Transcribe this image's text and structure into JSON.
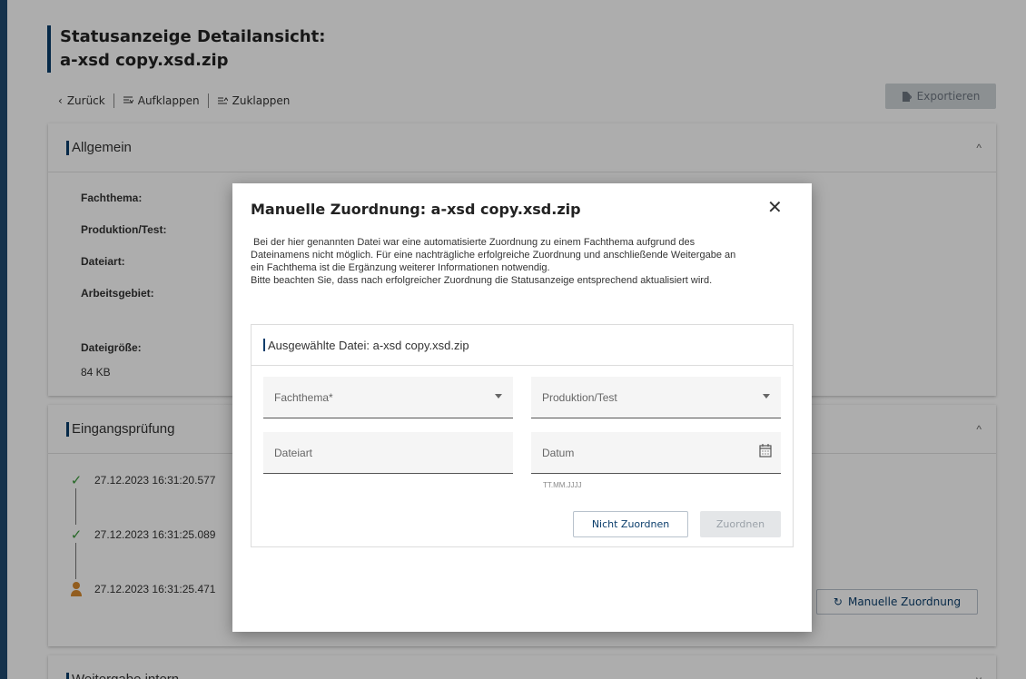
{
  "page": {
    "title_line1": "Statusanzeige Detailansicht:",
    "title_line2": "a-xsd copy.xsd.zip"
  },
  "toolbar": {
    "back_label": "Zurück",
    "expand_label": "Aufklappen",
    "collapse_label": "Zuklappen",
    "export_label": "Exportieren"
  },
  "sections": {
    "general": {
      "title": "Allgemein",
      "labels": [
        "Fachthema:",
        "Produktion/Test:",
        "Dateiart:",
        "Arbeitsgebiet:",
        "Dateigröße:"
      ],
      "filesize_value": "84 KB"
    },
    "entry_check": {
      "title": "Eingangsprüfung",
      "timestamps": [
        "27.12.2023 16:31:20.577",
        "27.12.2023 16:31:25.089",
        "27.12.2023 16:31:25.471"
      ],
      "manual_button_label": "Manuelle Zuordnung"
    },
    "forwarding": {
      "title": "Weitergabe intern"
    }
  },
  "dialog": {
    "title": "Manuelle Zuordnung: a-xsd copy.xsd.zip",
    "text_line1": "Bei der hier genannten Datei war eine automatisierte Zuordnung zu einem Fachthema aufgrund des",
    "text_line2": "Dateinamens nicht möglich. Für eine nachträgliche erfolgreiche Zuordnung und anschließende Weitergabe an",
    "text_line3": "ein Fachthema ist die Ergänzung weiterer Informationen notwendig.",
    "text_line4": "Bitte beachten Sie, dass nach erfolgreicher Zuordnung die Statusanzeige entsprechend aktualisiert wird.",
    "selected_file_label": "Ausgewählte Datei: a-xsd copy.xsd.zip",
    "fields": {
      "fachthema_placeholder": "Fachthema*",
      "produktion_placeholder": "Produktion/Test",
      "dateiart_placeholder": "Dateiart",
      "datum_placeholder": "Datum",
      "datum_hint": "TT.MM.JJJJ"
    },
    "buttons": {
      "not_assign": "Nicht Zuordnen",
      "assign": "Zuordnen"
    }
  },
  "colors": {
    "accent": "#0a3d6b",
    "success": "#3a9a3a",
    "warning": "#d88a2e"
  }
}
